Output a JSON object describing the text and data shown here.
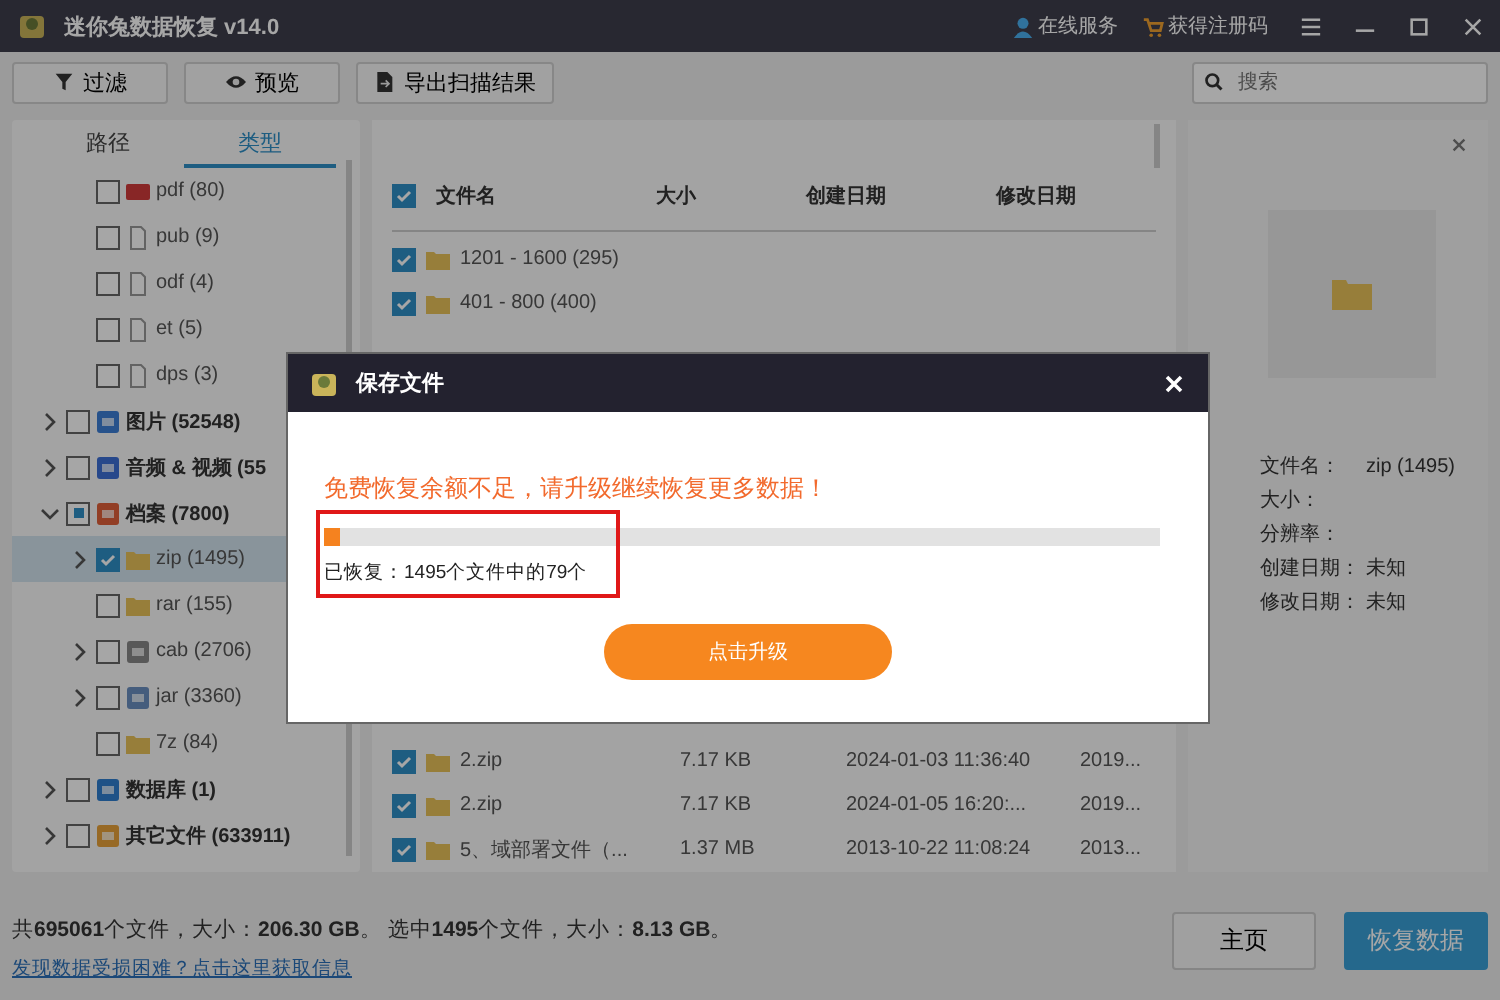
{
  "app": {
    "title": "迷你兔数据恢复 v14.0",
    "links": [
      {
        "label": "在线服务",
        "kind": "person"
      },
      {
        "label": "获得注册码",
        "kind": "cart"
      }
    ]
  },
  "toolbar": {
    "buttons": [
      {
        "label": "过滤",
        "kind": "filter"
      },
      {
        "label": "预览",
        "kind": "eye"
      },
      {
        "label": "导出扫描结果",
        "kind": "export"
      }
    ],
    "search": {
      "placeholder": "搜索"
    }
  },
  "sidebar": {
    "tabs": [
      {
        "label": "路径",
        "selected": false
      },
      {
        "label": "类型",
        "selected": true
      }
    ],
    "tree_continued": [
      {
        "label": "pdf (80)",
        "kind": "pdf",
        "checked": false,
        "partial": false,
        "selected": false
      },
      {
        "label": "pub (9)",
        "kind": "file",
        "checked": false,
        "partial": false,
        "selected": false
      },
      {
        "label": "odf (4)",
        "kind": "file",
        "checked": false,
        "partial": false,
        "selected": false
      },
      {
        "label": "et (5)",
        "kind": "file",
        "checked": false,
        "partial": false,
        "selected": false
      },
      {
        "label": "dps (3)",
        "kind": "file",
        "checked": false,
        "partial": false,
        "selected": false
      }
    ],
    "tree": [
      {
        "label": "图片 (52548)",
        "kind": "image",
        "checked": false,
        "partial": false,
        "selected": false,
        "expanded": false
      },
      {
        "label": "音频 & 视频 (55",
        "kind": "media",
        "checked": false,
        "partial": false,
        "selected": false,
        "expanded": false
      },
      {
        "label": "档案 (7800)",
        "kind": "archive",
        "checked": false,
        "partial": true,
        "selected": false,
        "expanded": true,
        "children": [
          {
            "label": "zip (1495)",
            "kind": "folder",
            "checked": true,
            "partial": false,
            "selected": true,
            "expanded": false
          },
          {
            "label": "rar (155)",
            "kind": "folder",
            "checked": false,
            "partial": false,
            "selected": false
          },
          {
            "label": "cab (2706)",
            "kind": "cab",
            "checked": false,
            "partial": false,
            "selected": false,
            "expanded": false
          },
          {
            "label": "jar (3360)",
            "kind": "jar",
            "checked": false,
            "partial": false,
            "selected": false,
            "expanded": false
          },
          {
            "label": "7z (84)",
            "kind": "folder",
            "checked": false,
            "partial": false,
            "selected": false
          }
        ]
      },
      {
        "label": "数据库 (1)",
        "kind": "db",
        "checked": false,
        "partial": false,
        "selected": false,
        "expanded": false
      },
      {
        "label": "其它文件 (633911)",
        "kind": "other",
        "checked": false,
        "partial": false,
        "selected": false,
        "expanded": false
      }
    ]
  },
  "files": {
    "all_checked": true,
    "columns": [
      "文件名",
      "大小",
      "创建日期",
      "修改日期"
    ],
    "rows_top": [
      {
        "name": "1201 - 1600 (295)",
        "checked": true
      },
      {
        "name": "401 - 800 (400)",
        "checked": true
      }
    ],
    "rows_bottom": [
      {
        "name": "2.zip",
        "size": "7.17 KB",
        "created": "2024-01-03 11:36:40",
        "modified": "2019...",
        "checked": true
      },
      {
        "name": "2.zip",
        "size": "7.17 KB",
        "created": "2024-01-05 16:20:...",
        "modified": "2019...",
        "checked": true
      },
      {
        "name": "5、域部署文件（...",
        "size": "1.37 MB",
        "created": "2013-10-22 11:08:24",
        "modified": "2013...",
        "checked": true
      }
    ]
  },
  "preview": {
    "fields": [
      {
        "label": "文件名：",
        "value": "zip (1495)"
      },
      {
        "label": "大小："
      },
      {
        "label": "分辨率："
      },
      {
        "label": "创建日期：",
        "value": "未知"
      },
      {
        "label": "修改日期：",
        "value": "未知"
      }
    ]
  },
  "status": {
    "summary": "共**695061**个文件，大小：**206.30 GB**。 选中**1495**个文件，大小：**8.13 GB**。",
    "link": "发现数据受损困难？点击这里获取信息",
    "buttons": [
      {
        "label": "主页",
        "kind": "secondary"
      },
      {
        "label": "恢复数据",
        "kind": "primary"
      }
    ]
  },
  "dialog": {
    "title": "保存文件",
    "warning": "免费恢复余额不足，请升级继续恢复更多数据！",
    "progress": {
      "level": 0.02
    },
    "status": "已恢复：1495个文件中的79个",
    "button": "点击升级"
  }
}
